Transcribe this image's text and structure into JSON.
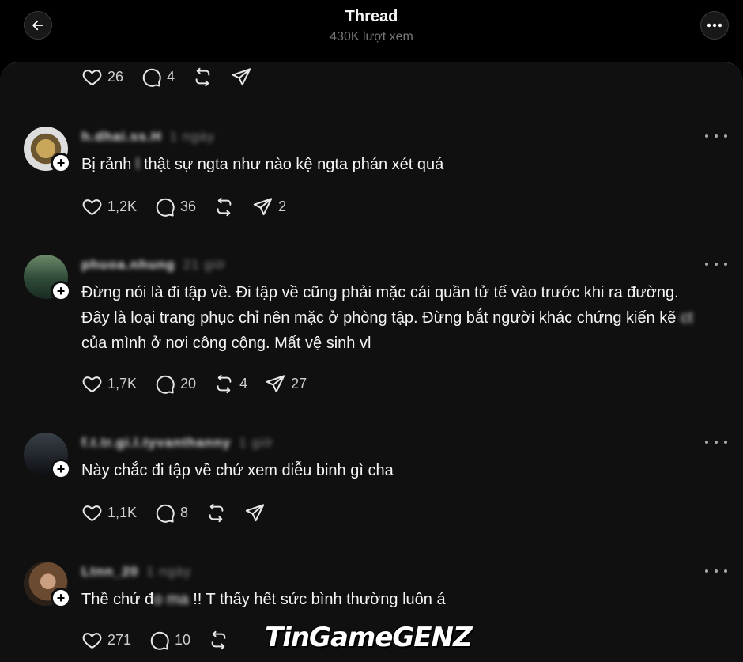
{
  "header": {
    "title": "Thread",
    "views": "430K lượt xem"
  },
  "top_actions": {
    "likes": "26",
    "replies": "4"
  },
  "posts": [
    {
      "username": "h.dhai.ss.H",
      "time": "1 ngày",
      "text_before": "Bị rảnh ",
      "text_censored": "l",
      "text_after": " thật sự ngta như nào kệ ngta phán xét quá",
      "likes": "1,2K",
      "replies": "36",
      "reposts": "",
      "shares": "2"
    },
    {
      "username": "phuoa.nhung",
      "time": "21 giờ",
      "text": "Đừng nói là đi tập về. Đi tập về cũng phải mặc cái quần tử tế vào trước khi ra đường. Đây là loại trang phục chỉ nên mặc ở phòng tập. Đừng bắt người khác chứng kiến kẽ ",
      "text_censored": "ct",
      "text_after": " của mình ở nơi công cộng. Mất vệ sinh vl",
      "likes": "1,7K",
      "replies": "20",
      "reposts": "4",
      "shares": "27"
    },
    {
      "username": "f.t.tr.gi.l.tyvanthanny",
      "time": "1 giờ",
      "text": "Này chắc đi tập về chứ xem diễu binh gì cha",
      "likes": "1,1K",
      "replies": "8",
      "reposts": "",
      "shares": ""
    },
    {
      "username": "Ltnn_20",
      "time": "1 ngày",
      "text_before": "Thề chứ đ",
      "text_censored": "o ma ",
      "text_after": "!! T thấy hết sức bình thường luôn á",
      "likes": "271",
      "replies": "10",
      "reposts": "",
      "shares": ""
    }
  ],
  "watermark": "TinGameGENZ",
  "icons": [
    "back-arrow-icon",
    "more-icon",
    "heart-icon",
    "comment-icon",
    "repost-icon",
    "share-icon",
    "follow-plus-icon"
  ]
}
